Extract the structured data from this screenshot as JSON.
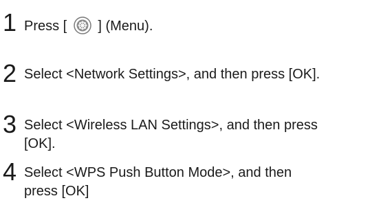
{
  "steps": [
    {
      "number": "1",
      "text_before_icon": "Press [",
      "icon": "menu-button-icon",
      "text_after_icon": "] (Menu)."
    },
    {
      "number": "2",
      "lines": [
        "Select <Network Settings>, and then press [OK]."
      ]
    },
    {
      "number": "3",
      "lines": [
        "Select <Wireless LAN Settings>, and then press",
        "[OK]."
      ]
    },
    {
      "number": "4",
      "lines": [
        "Select <WPS Push Button Mode>, and then",
        "press [OK]"
      ]
    }
  ],
  "colors": {
    "text": "#1a1a1a",
    "icon_outer": "#ffffff",
    "icon_inner": "#8a8a8a"
  }
}
